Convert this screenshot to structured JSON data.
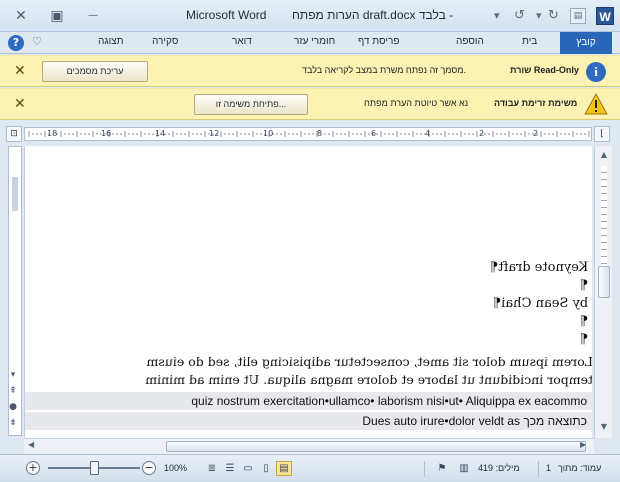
{
  "titlebar": {
    "title": "הערות מפתח draft.docx בלבד -",
    "app_name": "Microsoft Word",
    "close_glyph": "✕",
    "restore_glyph": "▣",
    "minimize_glyph": "—",
    "app_logo_letter": "W"
  },
  "qat": {
    "save_icon": "save-icon",
    "undo_icon": "undo-icon",
    "redo_icon": "redo-icon"
  },
  "ribbon": {
    "tabs": [
      {
        "label": "קובץ"
      },
      {
        "label": "בית"
      },
      {
        "label": "הוספה"
      },
      {
        "label": "פריסת דף"
      },
      {
        "label": "חומרי עזר"
      },
      {
        "label": "דואר"
      },
      {
        "label": "סקירה"
      },
      {
        "label": "תצוגה"
      }
    ]
  },
  "messagebars": {
    "readonly": {
      "mode_label": "שורת Read-Only",
      "message": "מסמך זה נפתח משרת במצב לקריאה בלבד.",
      "button": "עריכת מסמכים"
    },
    "workflow": {
      "title": "משימת זרימת עבודה",
      "message": "נא אשר טיוטת הערת מפתח",
      "button": "פתיחת משימה זו..."
    }
  },
  "ruler": {
    "numbers": [
      "18",
      "16",
      "14",
      "12",
      "10",
      "8",
      "6",
      "4",
      "2",
      "2"
    ]
  },
  "document": {
    "lines": [
      {
        "text": "Keynote draft¶"
      },
      {
        "text": "¶"
      },
      {
        "text": "by Sean Chai¶"
      },
      {
        "text": "¶"
      },
      {
        "text": "¶"
      }
    ],
    "paragraph": [
      "Lorem ipsum dolor sit amet, consectetur adipisicing elit, sed do eiusm",
      "tempor incididunt ut labore et dolore magna aliqua. Ut enim ad minim"
    ],
    "highlighted": [
      "quiz nostrum exercitation•ullamco• laborism nisi•ut• Aliquippa ex eacommo",
      "Dues auto irure•dolor veldt as  כתוצאה מכך"
    ]
  },
  "statusbar": {
    "page": "עמוד: מתוך",
    "page_num": "1",
    "words": "מילים: 419",
    "zoom": "100%",
    "zoom_level": 0.5
  }
}
